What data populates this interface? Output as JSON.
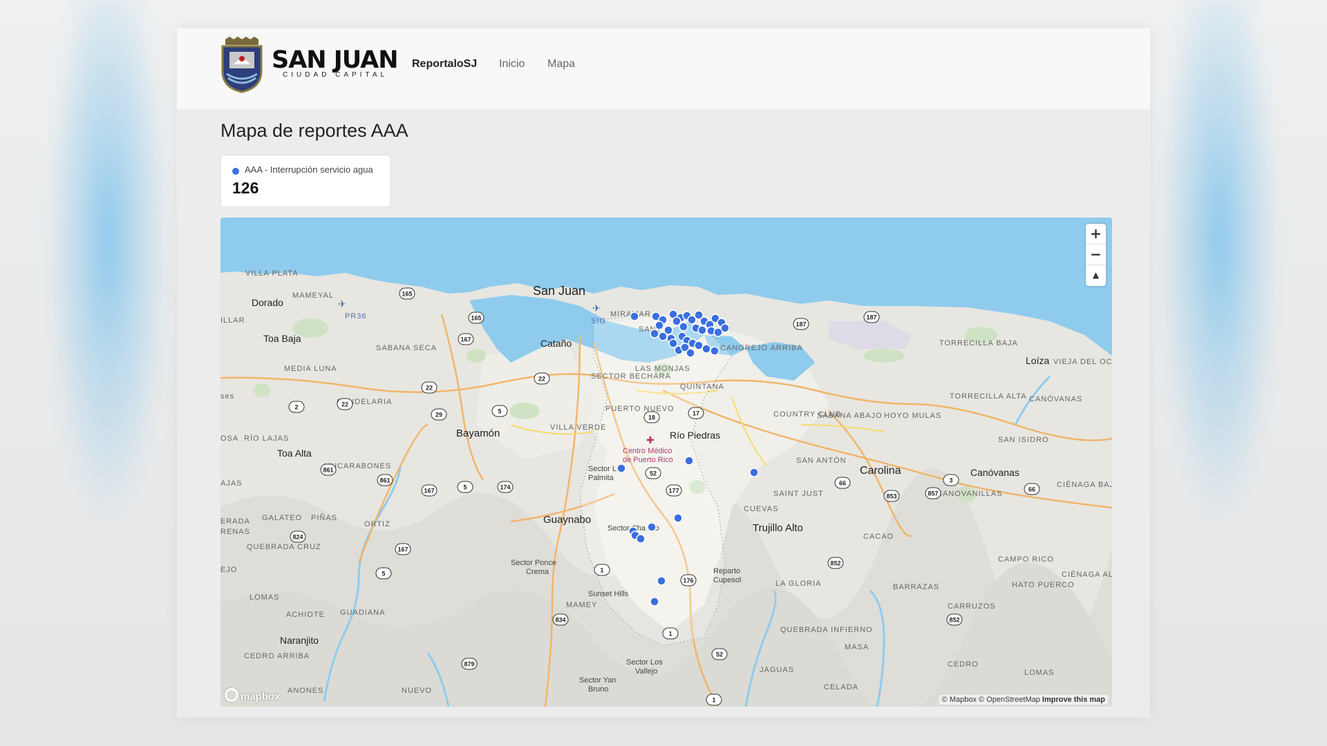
{
  "header": {
    "brand_name": "SAN JUAN",
    "brand_subtitle": "CIUDAD CAPITAL",
    "app_name": "ReportaloSJ",
    "nav": [
      {
        "label": "Inicio"
      },
      {
        "label": "Mapa"
      }
    ]
  },
  "page": {
    "title": "Mapa de reportes AAA"
  },
  "summary_card": {
    "label": "AAA - Interrupción servicio agua",
    "count": "126",
    "dot_color": "#3b6fe0"
  },
  "map": {
    "controls": {
      "zoom_in": "+",
      "zoom_out": "−",
      "compass": "▲"
    },
    "attribution": {
      "mapbox": "© Mapbox",
      "osm": "© OpenStreetMap",
      "improve": "Improve this map"
    },
    "logo": "mapbox",
    "marker_color": "#3b6fe0",
    "labels": {
      "san_juan": "San Juan",
      "dorado": "Dorado",
      "toa_baja": "Toa Baja",
      "catano": "Cataño",
      "bayamon": "Bayamón",
      "toa_alta": "Toa Alta",
      "guaynabo": "Guaynabo",
      "rio_piedras": "Río Piedras",
      "carolina": "Carolina",
      "canovanas": "Canóvanas",
      "trujillo_alto": "Trujillo Alto",
      "loiza": "Loíza",
      "naranjito": "Naranjito",
      "mameyal": "MAMEYAL",
      "villa_plata": "VILLA PLATA",
      "pr36": "PR36",
      "sabana_seca": "SABANA SECA",
      "media_luna": "MEDIA LUNA",
      "candelaria": "CANDELARIA",
      "rio_lajas": "RÍO LAJAS",
      "mucarabones": "MUCARABONES",
      "galateo": "GALATEO",
      "pinas": "PIÑAS",
      "ortiz": "ORTIZ",
      "quebrada_cruz": "QUEBRADA CRUZ",
      "lomas": "LOMAS",
      "achiote": "ACHIOTE",
      "guadiana": "GUADIANA",
      "cedro_arriba": "CEDRO ARRIBA",
      "anones": "ANONES",
      "nuevo": "NUEVO",
      "sig": "SIG",
      "miramar": "MIRAMAR",
      "santurce": "SANT",
      "sector_bechara": "SECTOR BECHARA",
      "las_monjas": "LAS MONJAS",
      "quintana": "QUINTANA",
      "puerto_nuevo": "PUERTO NUEVO",
      "villa_verde": "VILLA VERDE",
      "centro_medico": "Centro Médico",
      "centro_medico2": "de Puerto Rico",
      "sector_palmita": "Sector L",
      "palmita": "Palmita",
      "sector_chacho": "Sector Cha",
      "sector_chacho2": "ro",
      "sector_ponce": "Sector Ponce",
      "crema": "Crema",
      "sunset_hills": "Sunset Hills",
      "mamey": "MAMEY",
      "sector_los_vallejo": "Sector Los",
      "vallejo": "Vallejo",
      "sector_yan_bruno": "Sector Yan",
      "bruno": "Bruno",
      "reparto_cupesol": "Reparto",
      "cupesol": "Cupesol",
      "cangrejo_arriba": "CANGREJO ARRIBA",
      "torrecilla_baja": "TORRECILLA BAJA",
      "vieja_del_oceano": "VIEJA DEL OCÉANO",
      "country_club": "COUNTRY CLUB",
      "sabana_abajo": "SABANA ABAJO",
      "hoyo_mulas": "HOYO MULAS",
      "torrecilla_alta": "TORRECILLA ALTA",
      "canovanas_b": "CANÓVANAS",
      "san_isidro": "SAN ISIDRO",
      "san_anton": "SAN ANTÓN",
      "saint_just": "SAINT JUST",
      "cuevas": "CUEVAS",
      "canovanillas": "CANOVANILLAS",
      "cienaga_baja": "CIÉNAGA BAJA",
      "cacao": "CACAO",
      "campo_rico": "CAMPO RICO",
      "la_gloria": "LA GLORIA",
      "barrazas": "BARRAZAS",
      "hato_puerco": "HATO PUERCO",
      "cienaga_alta": "CIÉNAGA ALTA",
      "carruzos": "CARRUZOS",
      "quebrada_infierno": "QUEBRADA INFIERNO",
      "masa": "MASA",
      "jaguas": "JAGUAS",
      "cedro": "CEDRO",
      "celada": "CELADA",
      "lomas_b": "LOMAS",
      "ses": "ses",
      "illar": "ILLAR",
      "osa": "OSA",
      "ajas": "AJAS",
      "erada": "ERADA",
      "renas": "RENAS",
      "ejo": "EJO"
    },
    "shields": [
      "165",
      "165",
      "167",
      "22",
      "22",
      "29",
      "5",
      "2",
      "22",
      "18",
      "17",
      "187",
      "187",
      "861",
      "861",
      "167",
      "5",
      "174",
      "52",
      "177",
      "824",
      "167",
      "5",
      "1",
      "176",
      "834",
      "1",
      "879",
      "52",
      "1",
      "66",
      "853",
      "857",
      "3",
      "66",
      "852",
      "852"
    ]
  }
}
